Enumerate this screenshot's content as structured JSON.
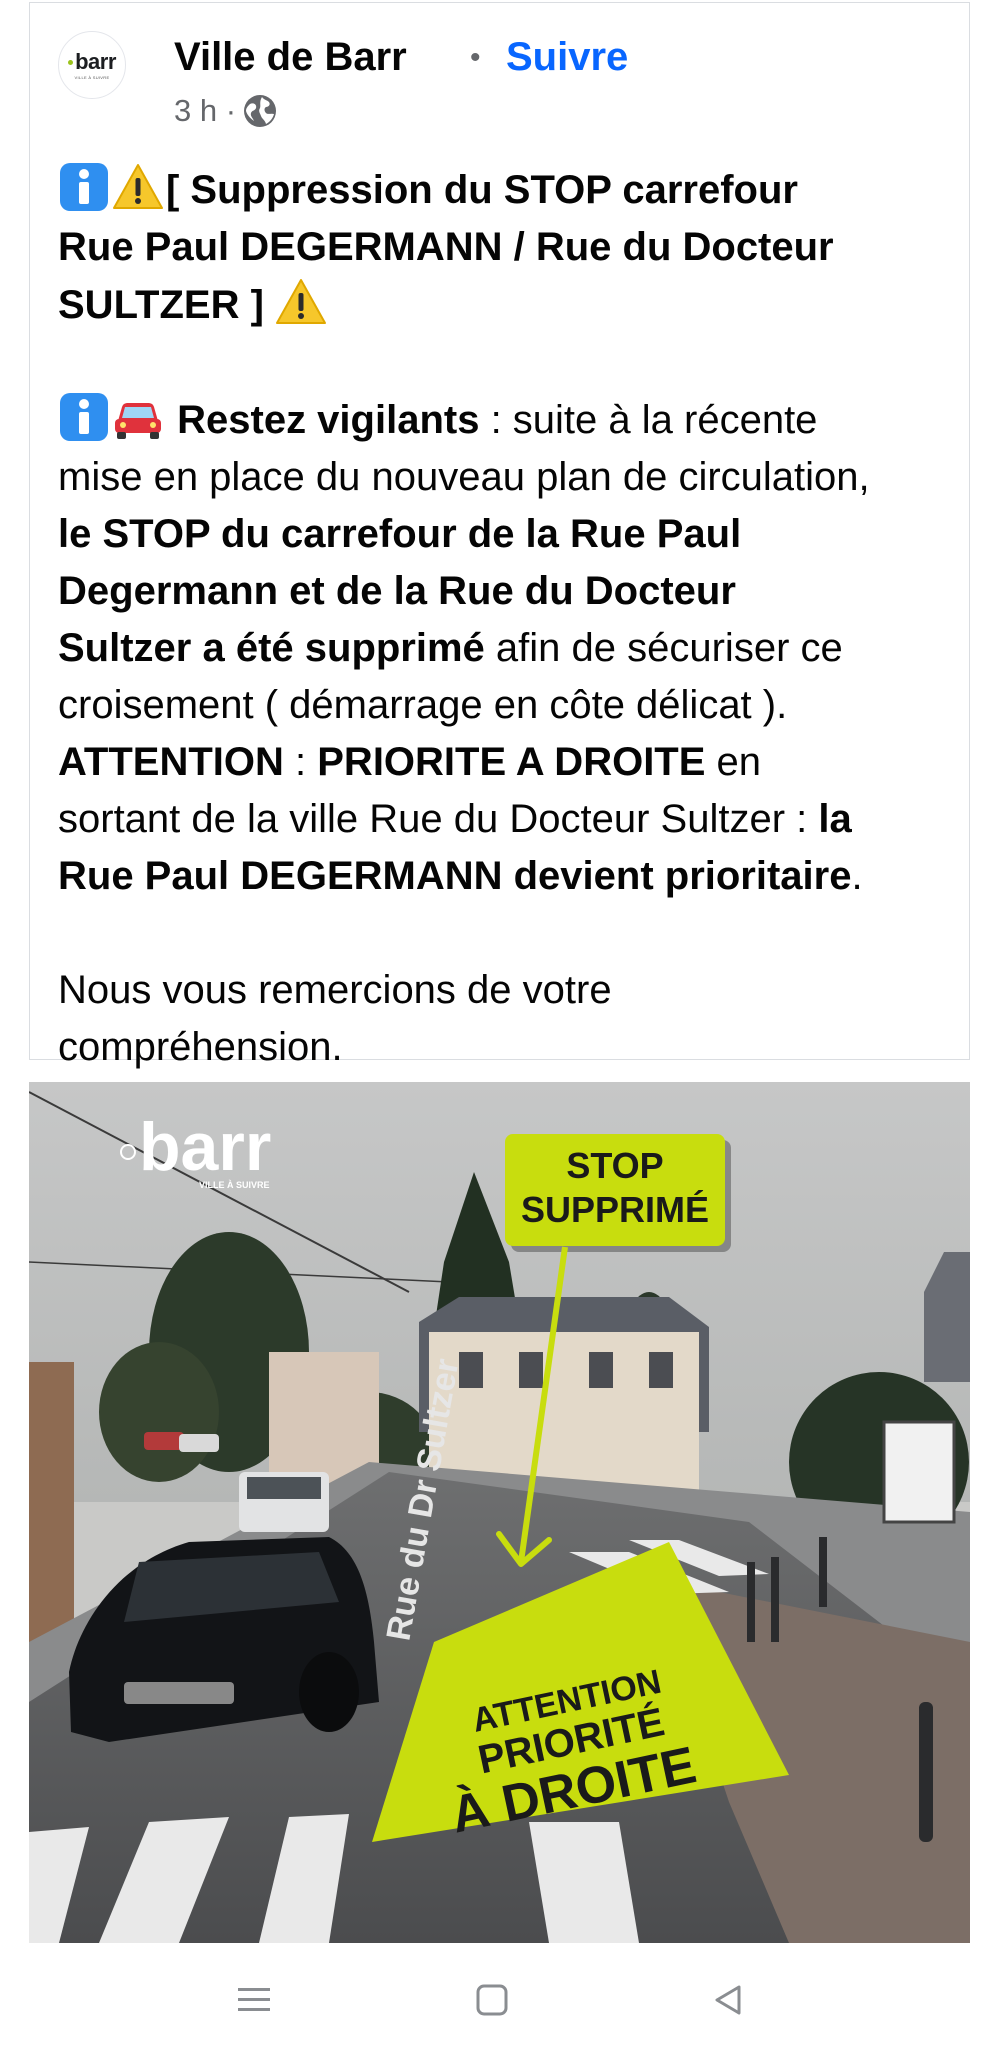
{
  "post": {
    "page_name": "Ville de Barr",
    "follow_separator": "•",
    "follow_label": "Suivre",
    "time": "3 h ·",
    "avatar_logo_text": "barr",
    "avatar_logo_sub": "VILLE À SUIVRE",
    "text": {
      "l1_rest": "[ Suppression du STOP carrefour",
      "l2": "Rue Paul DEGERMANN / Rue du Docteur",
      "l3": "SULTZER ]",
      "l4_bold": "Restez vigilants",
      "l4_rest": " : suite à la récente",
      "l5": "mise en place du nouveau plan de circulation,",
      "l6": "le STOP du carrefour de la Rue Paul",
      "l7": "Degermann et de la Rue du Docteur",
      "l8_bold": "Sultzer a été supprimé",
      "l8_rest": " afin de sécuriser ce",
      "l9": "croisement ( démarrage en côte délicat ).",
      "l10_bold1": "ATTENTION",
      "l10_mid": " :  ",
      "l10_bold2": "PRIORITE A DROITE",
      "l10_rest": " en",
      "l11_rest": "sortant de la ville Rue du Docteur Sultzer : ",
      "l11_bold": "la",
      "l12_bold": "Rue Paul DEGERMANN devient prioritaire",
      "l12_rest": ".",
      "l13": "Nous vous remercions de votre",
      "l14": "compréhension."
    }
  },
  "photo": {
    "logo_text": "barr",
    "logo_sub": "VILLE À SUIVRE",
    "stop_line1": "STOP",
    "stop_line2": "SUPPRIMÉ",
    "attention_line1": "ATTENTION",
    "attention_line2": "PRIORITÉ",
    "attention_line3": "À DROITE",
    "street_sign_text": "Rue du Dr Sultzer",
    "accent_color": "#c8dd0e"
  },
  "nav": {
    "icons": [
      "menu-icon",
      "home-square-icon",
      "back-triangle-icon"
    ]
  }
}
